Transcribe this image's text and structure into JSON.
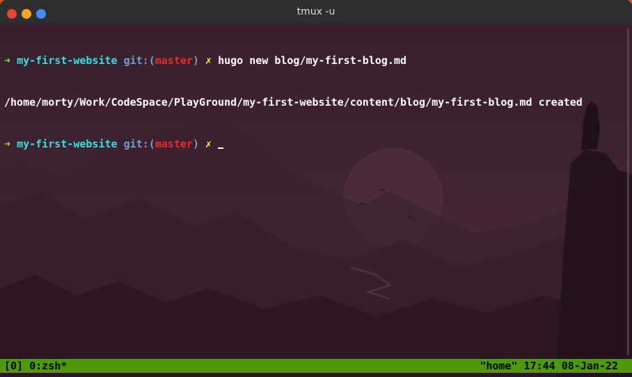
{
  "window": {
    "title": "tmux -u"
  },
  "terminal": {
    "lines": [
      {
        "arrow": "➜",
        "dir": "my-first-website",
        "git_prefix": "git:(",
        "branch": "master",
        "git_suffix": ")",
        "dirty": "✗",
        "command": "hugo new blog/my-first-blog.md"
      },
      {
        "output": "/home/morty/Work/CodeSpace/PlayGround/my-first-website/content/blog/my-first-blog.md created"
      },
      {
        "arrow": "➜",
        "dir": "my-first-website",
        "git_prefix": "git:(",
        "branch": "master",
        "git_suffix": ")",
        "dirty": "✗",
        "command": ""
      }
    ]
  },
  "statusbar": {
    "session": "[0] 0:zsh*",
    "host": "\"home\"",
    "time": "17:44",
    "date": "08-Jan-22"
  },
  "colors": {
    "prompt_arrow": "#8ae234",
    "directory": "#34e2e2",
    "git": "#729fcf",
    "branch": "#ef2929",
    "dirty_mark": "#fce94f",
    "status_bar": "#4e9a06"
  },
  "icons": [
    "close-icon",
    "minimize-icon",
    "maximize-icon"
  ]
}
